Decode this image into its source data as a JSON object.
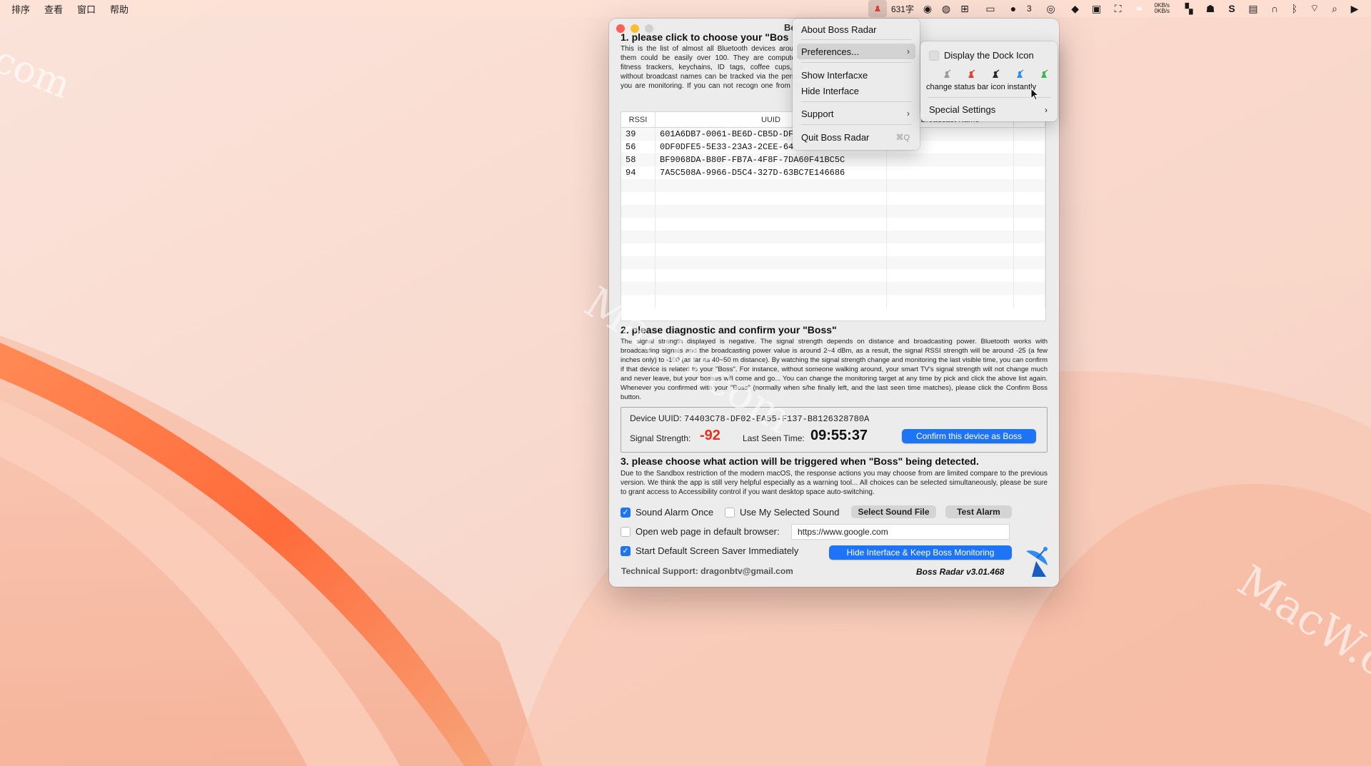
{
  "menubar": {
    "menus": [
      "排序",
      "查看",
      "窗口",
      "帮助"
    ],
    "word_count": "631字",
    "wechat_count": "3",
    "net_up": "0KB/s",
    "net_down": "0KB/s",
    "icons": [
      "boss-radar-icon",
      "text-icon",
      "mic-icon",
      "grid-icon",
      "camera-icon",
      "wechat-icon",
      "cloud-icon",
      "app-icon",
      "app-icon-2",
      "screen-icon",
      "leaf-icon",
      "bookmark-icon",
      "rocket-icon",
      "s-icon",
      "s-box-icon",
      "headphones-icon",
      "bluetooth-icon",
      "wifi-off-icon",
      "search-icon",
      "play-icon"
    ]
  },
  "window": {
    "title": "Bo",
    "section1": {
      "title": "1. please click to choose your \"Bos",
      "text": "This is the list of almost all Bluetooth devices around, them could be easily over 100. They are computers, fitness trackers, keychains, ID tags, coffee cups, or without broadcast names can be tracked via the person you are monitoring. If you can not recogn one from the top area, they are those with strongest"
    },
    "table": {
      "headers": [
        "RSSI",
        "UUID",
        "Broadcast Name",
        ""
      ],
      "rows": [
        {
          "rssi": "39",
          "uuid": "601A6DB7-0061-BE6D-CB5D-DF"
        },
        {
          "rssi": "56",
          "uuid": "0DF0DFE5-5E33-23A3-2CEE-64"
        },
        {
          "rssi": "58",
          "uuid": "BF9068DA-B80F-FB7A-4F8F-7DA60F41BC5C"
        },
        {
          "rssi": "94",
          "uuid": "7A5C508A-9966-D5C4-327D-63BC7E146686"
        }
      ]
    },
    "section2": {
      "title": "2. please diagnostic and confirm your \"Boss\"",
      "text": "The signal strength displayed is negative. The signal strength depends on distance and broadcasting power. Bluetooth works with broadcasting signals and the broadcasting power value is around 2~4 dBm, as a result, the signal RSSI strength will be around -25 (a few inches only) to -100 (as far as 40~50 m distance). By watching the signal strength change and monitoring the last visible time, you can confirm if that device is related to your \"Boss\". For instance, without someone walking around, your smart TV's signal strength will not change much and never leave, but your bosses will come and go... You can change the monitoring target at any time by pick and click the above list again. Whenever you confirmed with your \"Boss\" (normally when s/he finally left, and the last seen time matches), please click the Confirm Boss button."
    },
    "device": {
      "uuid_label": "Device UUID:",
      "uuid_value": "74403C78-DF02-EA55-F137-B8126328780A",
      "signal_label": "Signal Strength:",
      "signal_value": "-92",
      "seen_label": "Last Seen Time:",
      "seen_value": "09:55:37",
      "confirm_button": "Confirm this device as Boss"
    },
    "section3": {
      "title": "3. please choose what action will be triggered when \"Boss\" being detected.",
      "text": "Due to the Sandbox restriction of the modern macOS, the response actions you may choose from are limited compare to the previous version. We think the app is still very helpful especially as a warning tool... All choices can be selected simultaneously, please be sure to grant access to Accessibility control if you want desktop space auto-switching."
    },
    "options": {
      "sound_alarm": "Sound Alarm Once",
      "use_sound": "Use My Selected Sound",
      "select_sound": "Select Sound File",
      "test_alarm": "Test Alarm",
      "open_web": "Open web page in default browser:",
      "url": "https://www.google.com",
      "screensaver": "Start Default Screen Saver Immediately",
      "hide_button": "Hide Interface & Keep Boss Monitoring"
    },
    "footer": {
      "support": "Technical Support: dragonbtv@gmail.com",
      "version": "Boss Radar v3.01.468"
    }
  },
  "menu": {
    "about": "About Boss Radar",
    "preferences": "Preferences...",
    "show": "Show Interfacxe",
    "hide": "Hide Interface",
    "support": "Support",
    "quit": "Quit Boss Radar",
    "quit_shortcut": "⌘Q",
    "arrow": "›"
  },
  "submenu": {
    "dock_icon": "Display the Dock Icon",
    "caption": "change status bar icon instantly",
    "special": "Special Settings",
    "icon_colors": [
      "#9a9a9a",
      "#e0403a",
      "#2a2a2a",
      "#2f8cf0",
      "#3cb550"
    ]
  },
  "watermark": "MacW.com",
  "colors": {
    "accent": "#1d74f5",
    "signal": "#e62f1e"
  }
}
